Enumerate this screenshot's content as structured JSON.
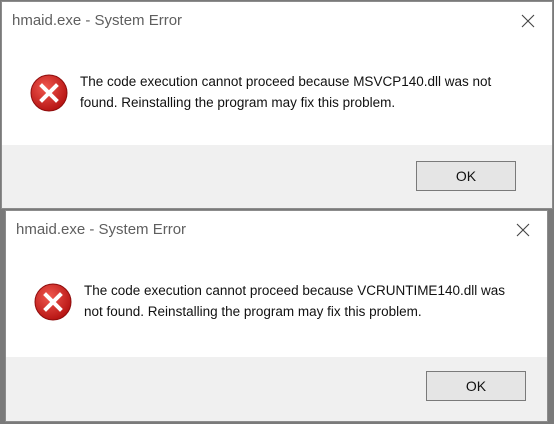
{
  "dialogs": [
    {
      "title": "hmaid.exe - System Error",
      "message": "The code execution cannot proceed because MSVCP140.dll was not found. Reinstalling the program may fix this problem.",
      "ok_label": "OK",
      "icon": "error-icon",
      "close_icon": "close-icon"
    },
    {
      "title": "hmaid.exe - System Error",
      "message": "The code execution cannot proceed because VCRUNTIME140.dll was not found. Reinstalling the program may fix this problem.",
      "ok_label": "OK",
      "icon": "error-icon",
      "close_icon": "close-icon"
    }
  ],
  "colors": {
    "error_red": "#d21f1f",
    "footer_bg": "#f0f0f0",
    "title_text": "#5f5f5f"
  }
}
